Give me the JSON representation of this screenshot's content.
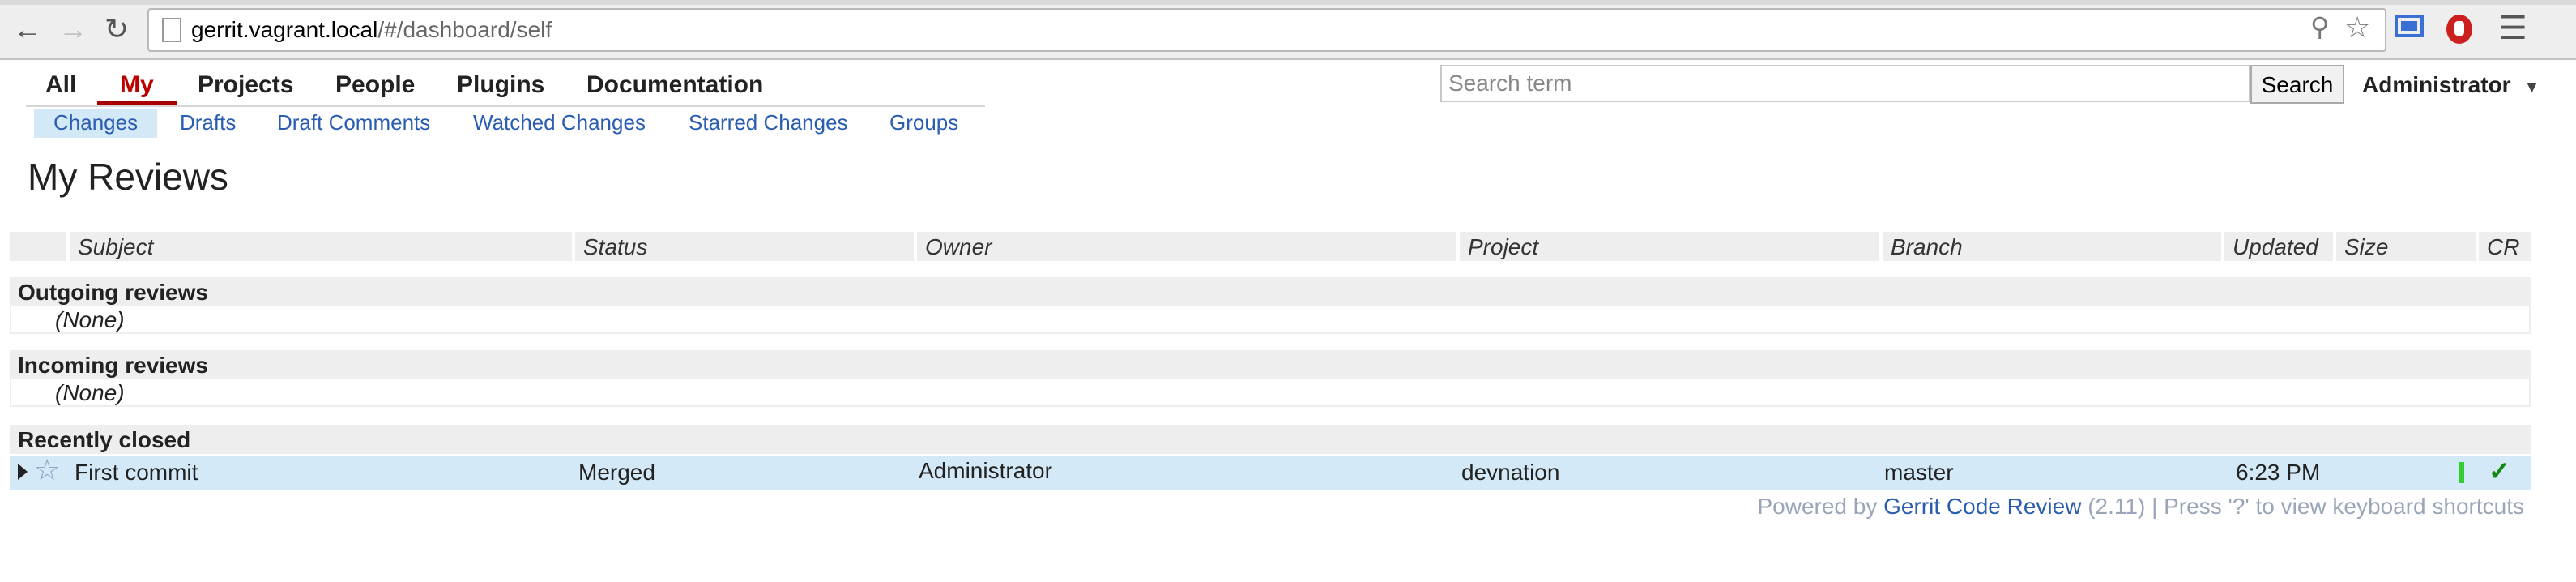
{
  "browser": {
    "url_host": "gerrit.vagrant.local",
    "url_path": "/#/dashboard/self"
  },
  "topnav": {
    "tabs": [
      {
        "label": "All",
        "active": false
      },
      {
        "label": "My",
        "active": true
      },
      {
        "label": "Projects",
        "active": false
      },
      {
        "label": "People",
        "active": false
      },
      {
        "label": "Plugins",
        "active": false
      },
      {
        "label": "Documentation",
        "active": false
      }
    ]
  },
  "subnav": {
    "items": [
      {
        "label": "Changes",
        "active": true
      },
      {
        "label": "Drafts",
        "active": false
      },
      {
        "label": "Draft Comments",
        "active": false
      },
      {
        "label": "Watched Changes",
        "active": false
      },
      {
        "label": "Starred Changes",
        "active": false
      },
      {
        "label": "Groups",
        "active": false
      }
    ]
  },
  "search": {
    "placeholder": "Search term",
    "button_label": "Search"
  },
  "user": {
    "name": "Administrator"
  },
  "page_title": "My Reviews",
  "table": {
    "columns": [
      "Subject",
      "Status",
      "Owner",
      "Project",
      "Branch",
      "Updated",
      "Size",
      "CR"
    ],
    "sections": [
      {
        "title": "Outgoing reviews",
        "empty_text": "(None)"
      },
      {
        "title": "Incoming reviews",
        "empty_text": "(None)"
      },
      {
        "title": "Recently closed"
      }
    ],
    "rows": [
      {
        "subject": "First commit",
        "status": "Merged",
        "owner": "Administrator",
        "project": "devnation",
        "branch": "master",
        "updated": "6:23 PM",
        "cr": "✓"
      }
    ]
  },
  "footer": {
    "prefix": "Powered by ",
    "link": "Gerrit Code Review",
    "suffix": " (2.11) | Press '?' to view keyboard shortcuts"
  },
  "colors": {
    "active_tab": "#bb0000",
    "link": "#2a5db0",
    "selected_row": "#d4e9f7",
    "size_bar": "#33cc33",
    "approved_check": "#118811"
  },
  "icons": {
    "back": "left-arrow",
    "forward": "right-arrow",
    "reload": "circular-arrow",
    "zoom": "magnifier",
    "bookmark": "star",
    "cast": "screen",
    "extension": "hand",
    "menu": "hamburger"
  }
}
